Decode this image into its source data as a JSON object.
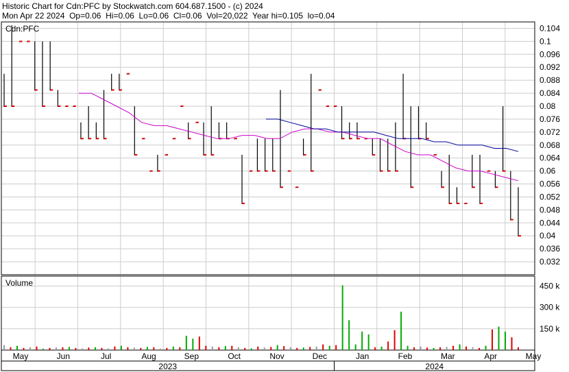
{
  "header": {
    "line1": "Historic Chart for Cdn:PFC by Stockwatch.com 604.687.1500 - (c) 2024",
    "line2": "Mon Apr 22 2024  Op=0.06  Hi=0.06  Lo=0.06  Cl=0.06  Vol=20,022  Year hi=0.105  lo=0.04"
  },
  "chart_data": [
    {
      "type": "ohlc",
      "title": "Cdn:PFC",
      "price_ylim": [
        0.028,
        0.106
      ],
      "y_ticks": [
        "0.104",
        "0.1",
        "0.096",
        "0.092",
        "0.088",
        "0.084",
        "0.08",
        "0.076",
        "0.072",
        "0.068",
        "0.064",
        "0.06",
        "0.056",
        "0.052",
        "0.048",
        "0.044",
        "0.04",
        "0.036",
        "0.032"
      ],
      "x_months": [
        "May",
        "Jun",
        "Jul",
        "Aug",
        "Sep",
        "Oct",
        "Nov",
        "Dec",
        "Jan",
        "Feb",
        "Mar",
        "Apr",
        "May"
      ],
      "x_years": [
        "2023",
        "2024"
      ],
      "colors": {
        "bar": "#000000",
        "close": "#dd0000",
        "ma_fast": "#cc00cc",
        "ma_slow": "#000099",
        "vol_up": "#00aa00",
        "vol_down": "#dd0000",
        "vol_flat": "#999999",
        "grid": "#cccccc"
      },
      "series": [
        {
          "values": [
            [
              0.09,
              0.08
            ],
            [
              0.105,
              0.08
            ],
            [
              0.1,
              0.1
            ],
            [
              0.1,
              0.1
            ],
            [
              0.1,
              0.085
            ],
            [
              0.1,
              0.08
            ],
            [
              0.1,
              0.085
            ],
            [
              0.085,
              0.08
            ],
            [
              0.08,
              0.08
            ],
            [
              0.08,
              0.08
            ],
            [
              0.075,
              0.07
            ],
            [
              0.08,
              0.07
            ],
            [
              0.075,
              0.07
            ],
            [
              0.085,
              0.07
            ],
            [
              0.09,
              0.085
            ],
            [
              0.09,
              0.085
            ],
            [
              0.09,
              0.09
            ],
            [
              0.08,
              0.065
            ],
            [
              0.07,
              0.07
            ],
            [
              0.06,
              0.06
            ],
            [
              0.065,
              0.06
            ],
            [
              0.065,
              0.065
            ],
            [
              0.07,
              0.07
            ],
            [
              0.08,
              0.08
            ],
            [
              0.075,
              0.07
            ],
            [
              0.075,
              0.075
            ],
            [
              0.075,
              0.065
            ],
            [
              0.08,
              0.065
            ],
            [
              0.075,
              0.07
            ],
            [
              0.075,
              0.07
            ],
            [
              0.07,
              0.07
            ],
            [
              0.065,
              0.05
            ],
            [
              0.06,
              0.06
            ],
            [
              0.07,
              0.06
            ],
            [
              0.07,
              0.06
            ],
            [
              0.07,
              0.06
            ],
            [
              0.085,
              0.055
            ],
            [
              0.06,
              0.06
            ],
            [
              0.055,
              0.055
            ],
            [
              0.07,
              0.065
            ],
            [
              0.09,
              0.06
            ],
            [
              0.085,
              0.085
            ],
            [
              0.08,
              0.08
            ],
            [
              0.08,
              0.08
            ],
            [
              0.08,
              0.07
            ],
            [
              0.075,
              0.07
            ],
            [
              0.075,
              0.07
            ],
            [
              0.07,
              0.07
            ],
            [
              0.07,
              0.065
            ],
            [
              0.07,
              0.06
            ],
            [
              0.07,
              0.06
            ],
            [
              0.075,
              0.06
            ],
            [
              0.09,
              0.07
            ],
            [
              0.08,
              0.055
            ],
            [
              0.08,
              0.07
            ],
            [
              0.075,
              0.07
            ],
            [
              0.065,
              0.065
            ],
            [
              0.06,
              0.055
            ],
            [
              0.065,
              0.05
            ],
            [
              0.055,
              0.05
            ],
            [
              0.05,
              0.05
            ],
            [
              0.065,
              0.055
            ],
            [
              0.065,
              0.05
            ],
            [
              0.06,
              0.06
            ],
            [
              0.06,
              0.055
            ],
            [
              0.08,
              0.06
            ],
            [
              0.06,
              0.045
            ],
            [
              0.055,
              0.04
            ]
          ]
        },
        {
          "values": [
            0.084,
            0.084,
            0.082,
            0.08,
            0.078,
            0.075,
            0.074,
            0.074,
            0.073,
            0.072,
            0.071,
            0.07,
            0.07,
            0.071,
            0.071,
            0.07,
            0.07,
            0.072,
            0.073,
            0.073,
            0.072,
            0.072,
            0.071,
            0.07,
            0.07,
            0.068,
            0.066,
            0.065,
            0.065,
            0.063,
            0.061,
            0.06,
            0.06,
            0.059,
            0.058,
            0.057
          ]
        },
        {
          "values": [
            0.076,
            0.076,
            0.075,
            0.074,
            0.073,
            0.073,
            0.072,
            0.072,
            0.072,
            0.072,
            0.071,
            0.07,
            0.07,
            0.07,
            0.069,
            0.069,
            0.068,
            0.068,
            0.068,
            0.067,
            0.067,
            0.066
          ]
        }
      ]
    },
    {
      "type": "bar",
      "title": "Volume",
      "y_ticks": [
        "450 k",
        "300 k",
        "150 k"
      ],
      "ylim": [
        0,
        520000
      ],
      "values": [
        35000,
        20000,
        30000,
        15000,
        20000,
        25000,
        10000,
        15000,
        18000,
        20000,
        22000,
        15000,
        12000,
        18000,
        20000,
        15000,
        12000,
        25000,
        30000,
        20000,
        18000,
        15000,
        22000,
        20000,
        10000,
        15000,
        25000,
        20000,
        100000,
        80000,
        95000,
        30000,
        25000,
        20000,
        28000,
        30000,
        20000,
        15000,
        12000,
        25000,
        18000,
        22000,
        35000,
        28000,
        20000,
        15000,
        18000,
        22000,
        25000,
        40000,
        30000,
        35000,
        455000,
        210000,
        40000,
        130000,
        110000,
        20000,
        25000,
        60000,
        140000,
        270000,
        30000,
        20000,
        25000,
        18000,
        15000,
        20000,
        22000,
        30000,
        40000,
        25000,
        20000,
        15000,
        30000,
        145000,
        165000,
        130000,
        90000,
        20000
      ]
    }
  ]
}
